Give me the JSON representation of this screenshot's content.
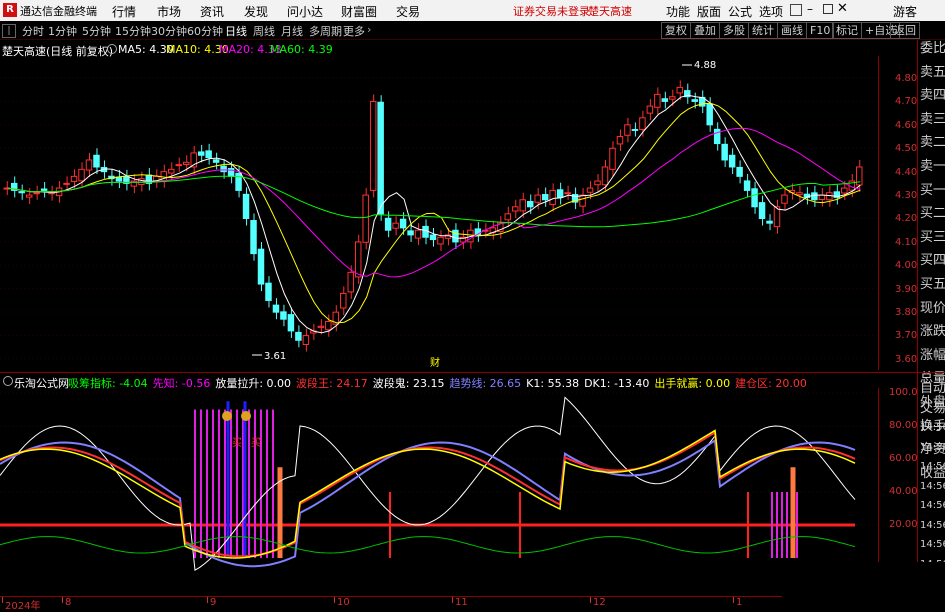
{
  "app": {
    "title": "通达信金融终端",
    "menu": [
      "行情",
      "市场",
      "资讯",
      "发现",
      "问小达",
      "财富圈",
      "交易"
    ],
    "login_status": "证券交易未登录",
    "stock_tag": "楚天高速",
    "right_menu": [
      "功能",
      "版面",
      "公式",
      "选项"
    ],
    "user": "游客"
  },
  "toolbar": {
    "periods": [
      "分时",
      "1分钟",
      "5分钟",
      "15分钟",
      "30分钟",
      "60分钟",
      "日线",
      "周线",
      "月线",
      "多周期",
      "更多"
    ],
    "active_period": "日线",
    "buttons": [
      "复权",
      "叠加",
      "多股",
      "统计",
      "画线",
      "F10",
      "标记",
      "+自选",
      "返回"
    ]
  },
  "main_chart": {
    "name": "楚天高速(日线 前复权)",
    "ma_labels": [
      {
        "text": "MA5: 4.30",
        "color": "#ffffff"
      },
      {
        "text": "MA10: 4.30",
        "color": "#ffff00"
      },
      {
        "text": "MA20: 4.33",
        "color": "#ff00ff"
      },
      {
        "text": "MA60: 4.39",
        "color": "#00ff00"
      }
    ],
    "y_ticks": [
      "4.80",
      "4.70",
      "4.60",
      "4.50",
      "4.40",
      "4.30",
      "4.20",
      "4.10",
      "4.00",
      "3.90",
      "3.80",
      "3.70",
      "3.60"
    ],
    "high_label": "4.88",
    "low_label": "3.61",
    "finance_marker": "财"
  },
  "sub_chart": {
    "name": "乐淘公式网",
    "indicators": [
      {
        "text": "吸筹指标: -4.04",
        "color": "#00ff00"
      },
      {
        "text": "先知: -0.56",
        "color": "#ff00ff"
      },
      {
        "text": "放量拉升: 0.00",
        "color": "#ffffff"
      },
      {
        "text": "波段王: 24.17",
        "color": "#ff3030"
      },
      {
        "text": "波段鬼: 23.15",
        "color": "#ffffff"
      },
      {
        "text": "趋势线: 26.65",
        "color": "#7f7fff"
      },
      {
        "text": "K1: 55.38",
        "color": "#ffffff"
      },
      {
        "text": "DK1: -13.40",
        "color": "#ffffff"
      },
      {
        "text": "出手就赢: 0.00",
        "color": "#ffff00"
      },
      {
        "text": "建仓区: 20.00",
        "color": "#ff3030"
      }
    ],
    "y_ticks": [
      "100.0",
      "80.00",
      "60.00",
      "40.00",
      "20.00"
    ],
    "buy_marks": [
      "买",
      "买"
    ]
  },
  "x_axis": {
    "labels": [
      "2024年",
      "8",
      "9",
      "10",
      "11",
      "12",
      "1"
    ]
  },
  "right_panel": {
    "top_items": [
      "委比",
      "卖五",
      "卖四",
      "卖三",
      "卖二",
      "卖一",
      "买一",
      "买二",
      "买三",
      "买四",
      "买五",
      "现价",
      "涨跌",
      "涨幅",
      "总量",
      "外盘",
      "换手",
      "净资",
      "收益"
    ],
    "bottom_items": [
      "自动",
      "交易",
      "14:56",
      "14:56",
      "14:56",
      "14:56",
      "14:56",
      "14:56",
      "14:56",
      "14:56",
      "14:56"
    ]
  }
}
